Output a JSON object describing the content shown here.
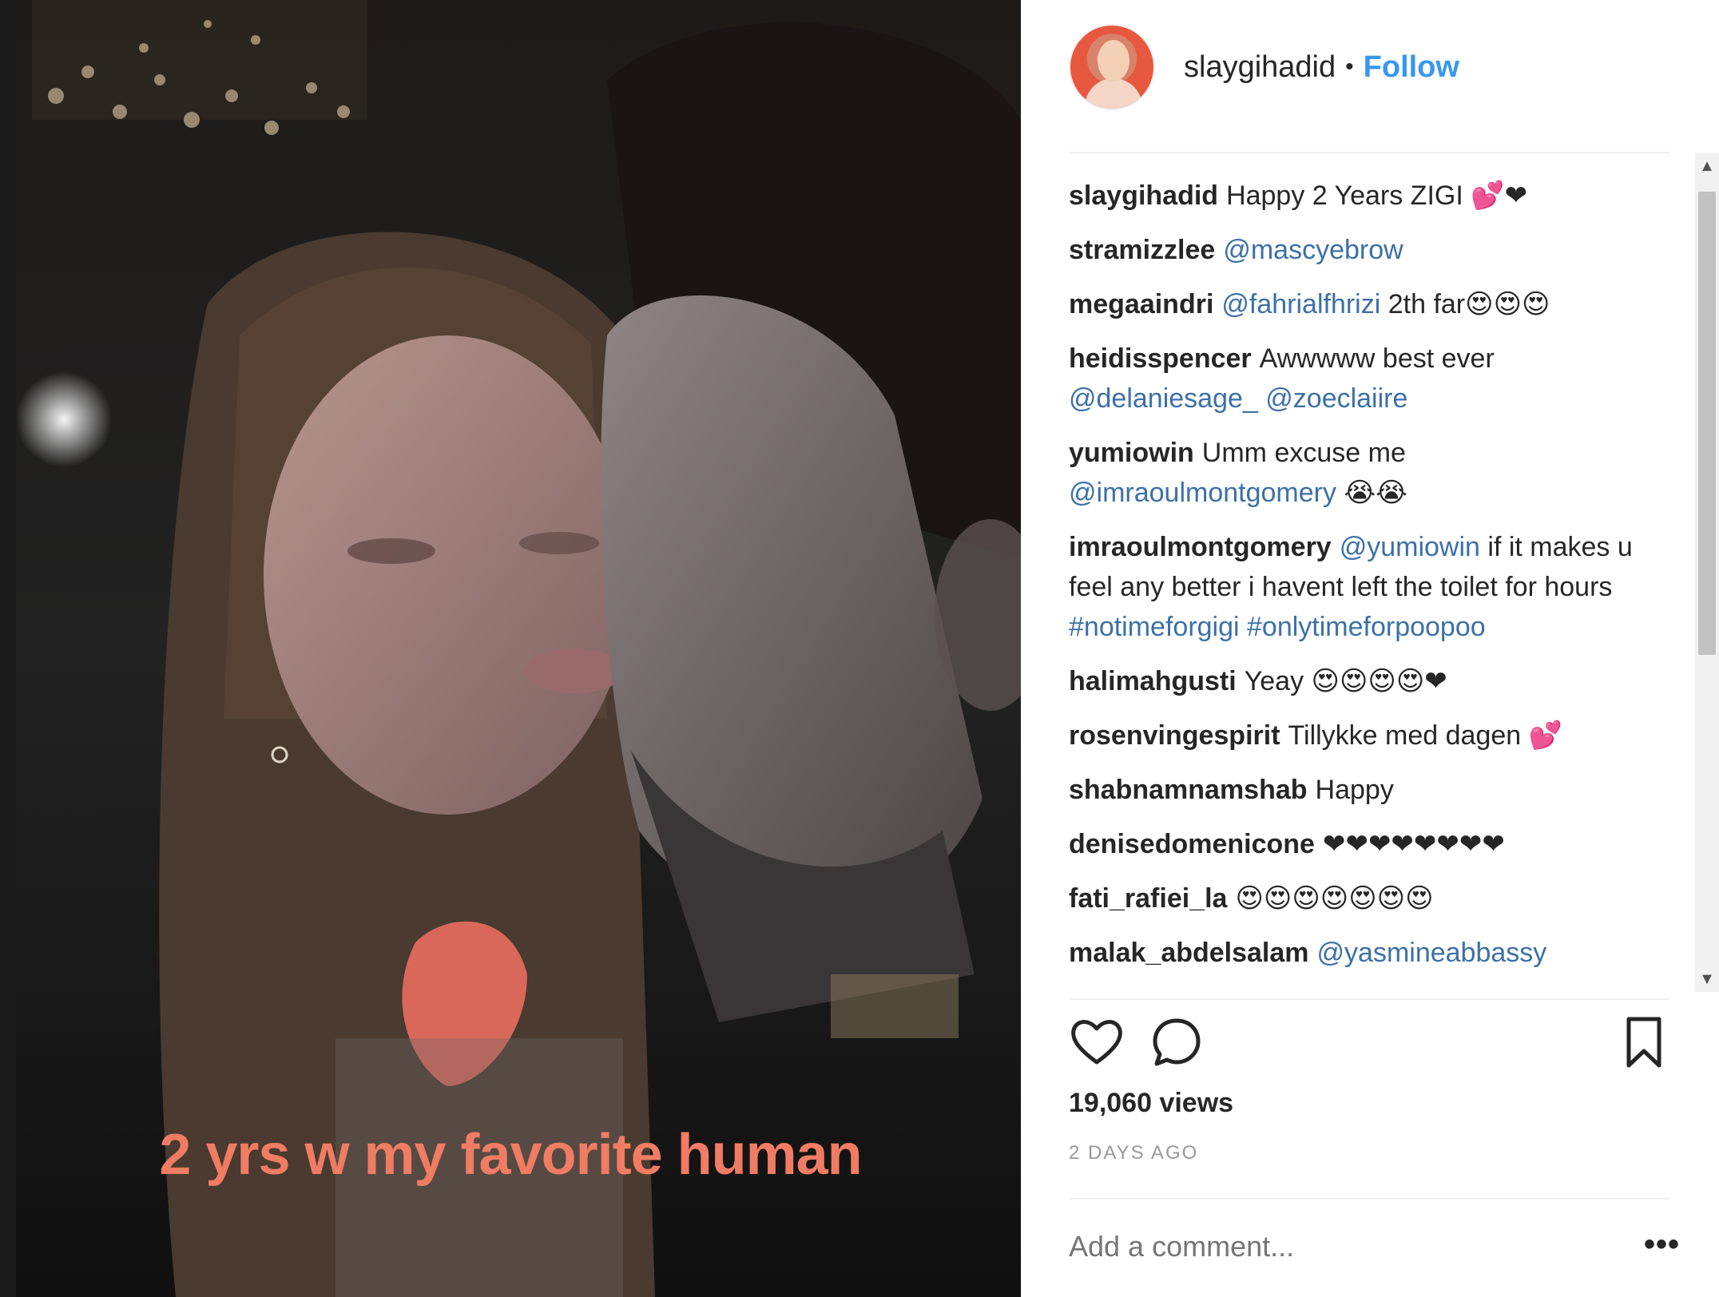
{
  "post": {
    "caption_overlay": "2 yrs w my favorite human",
    "author": "slaygihadid",
    "separator": "•",
    "follow_label": "Follow"
  },
  "comments": [
    {
      "user": "slaygihadid",
      "parts": [
        {
          "t": "text",
          "v": "Happy 2 Years ZIGI 💕❤"
        }
      ]
    },
    {
      "user": "stramizzlee",
      "parts": [
        {
          "t": "tag",
          "v": "@mascyebrow"
        }
      ]
    },
    {
      "user": "megaaindri",
      "parts": [
        {
          "t": "tag",
          "v": "@fahrialfhrizi"
        },
        {
          "t": "text",
          "v": " 2th far😍😍😍"
        }
      ]
    },
    {
      "user": "heidisspencer",
      "parts": [
        {
          "t": "text",
          "v": "Awwwww best ever "
        },
        {
          "t": "tag",
          "v": "@delaniesage_"
        },
        {
          "t": "text",
          "v": " "
        },
        {
          "t": "tag",
          "v": "@zoeclaiire"
        }
      ]
    },
    {
      "user": "yumiowin",
      "parts": [
        {
          "t": "text",
          "v": "Umm excuse me "
        },
        {
          "t": "tag",
          "v": "@imraoulmontgomery"
        },
        {
          "t": "text",
          "v": " 😭😭"
        }
      ]
    },
    {
      "user": "imraoulmontgomery",
      "parts": [
        {
          "t": "tag",
          "v": "@yumiowin"
        },
        {
          "t": "text",
          "v": " if it makes u feel any better i havent left the toilet for hours "
        },
        {
          "t": "tag",
          "v": "#notimeforgigi"
        },
        {
          "t": "text",
          "v": " "
        },
        {
          "t": "tag",
          "v": "#onlytimeforpoopoo"
        }
      ]
    },
    {
      "user": "halimahgusti",
      "parts": [
        {
          "t": "text",
          "v": "Yeay 😍😍😍😍❤"
        }
      ]
    },
    {
      "user": "rosenvingespirit",
      "parts": [
        {
          "t": "text",
          "v": "Tillykke med dagen 💕"
        }
      ]
    },
    {
      "user": "shabnamnamshab",
      "parts": [
        {
          "t": "text",
          "v": "Happy"
        }
      ]
    },
    {
      "user": "denisedomenicone",
      "parts": [
        {
          "t": "text",
          "v": "❤❤❤❤❤❤❤❤"
        }
      ]
    },
    {
      "user": "fati_rafiei_la",
      "parts": [
        {
          "t": "text",
          "v": "😍😍😍😍😍😍😍"
        }
      ]
    },
    {
      "user": "malak_abdelsalam",
      "parts": [
        {
          "t": "tag",
          "v": "@yasmineabbassy"
        }
      ]
    }
  ],
  "stats": {
    "views": "19,060 views",
    "timestamp": "2 DAYS AGO"
  },
  "comment_box": {
    "placeholder": "Add a comment...",
    "more_label": "•••"
  },
  "icons": {
    "like": "heart-icon",
    "comment": "comment-bubble-icon",
    "save": "bookmark-icon",
    "more": "more-options-icon"
  },
  "colors": {
    "follow": "#3897f0",
    "tag": "#3c70a8",
    "caption_overlay": "#f07c63",
    "muted": "#999999"
  }
}
